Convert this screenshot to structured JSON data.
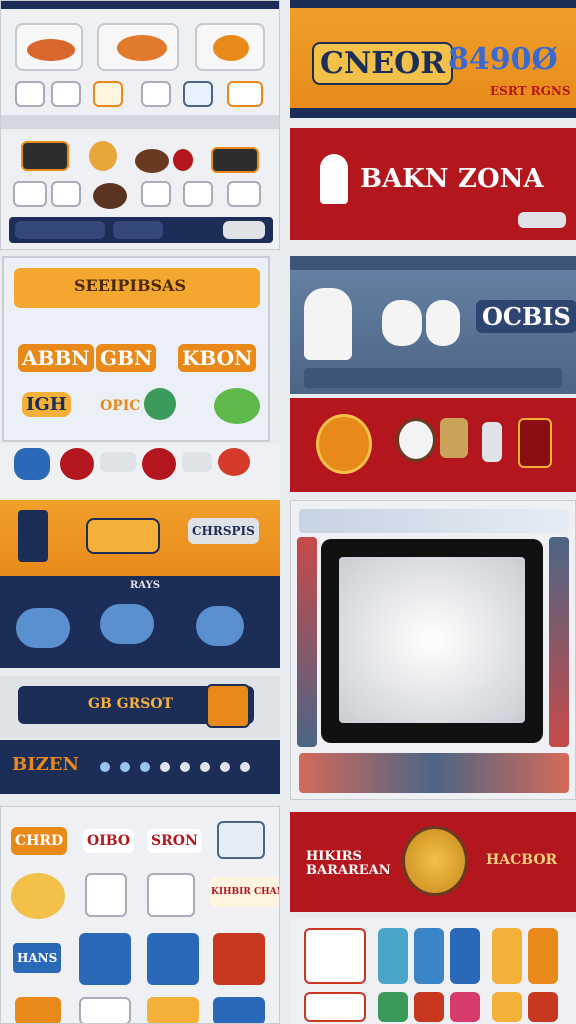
{
  "colors": {
    "orange": "#e8891a",
    "red": "#b3161c",
    "navy": "#1c2d57",
    "slate": "#4d6585",
    "silver": "#dfe3e8",
    "gold": "#f3b13a"
  },
  "panels": {
    "top_right_banner": {
      "text_left": "CNEOR",
      "text_right": "8490Ø",
      "sub": "ESRT RGNS"
    },
    "red_banner": {
      "text_left": "BAKN",
      "text_right": "ZONA"
    },
    "mid_left_ribbon": {
      "title": "SEEIPIBSAS",
      "row1": [
        "ABBN",
        "GBN",
        "KBON"
      ],
      "row2": [
        "IGH",
        "OPIC"
      ]
    },
    "slate_panel": {
      "text": "OCBIS"
    },
    "orange_strip": {
      "text": "CHRSPIS"
    },
    "navy_strip": {
      "title": "RAYS"
    },
    "nav_bar": {
      "label": "GB GRSOT"
    },
    "bottom_strip": {
      "label": "BIZEN"
    },
    "bottom_red_banner": {
      "left": "HIKIRS BARAREAN",
      "right": "HACBOR"
    },
    "bottom_left_grid": {
      "items": [
        "CHRD",
        "OIBO",
        "SRON",
        "KIHBIR CHAN",
        "HANS"
      ]
    }
  }
}
